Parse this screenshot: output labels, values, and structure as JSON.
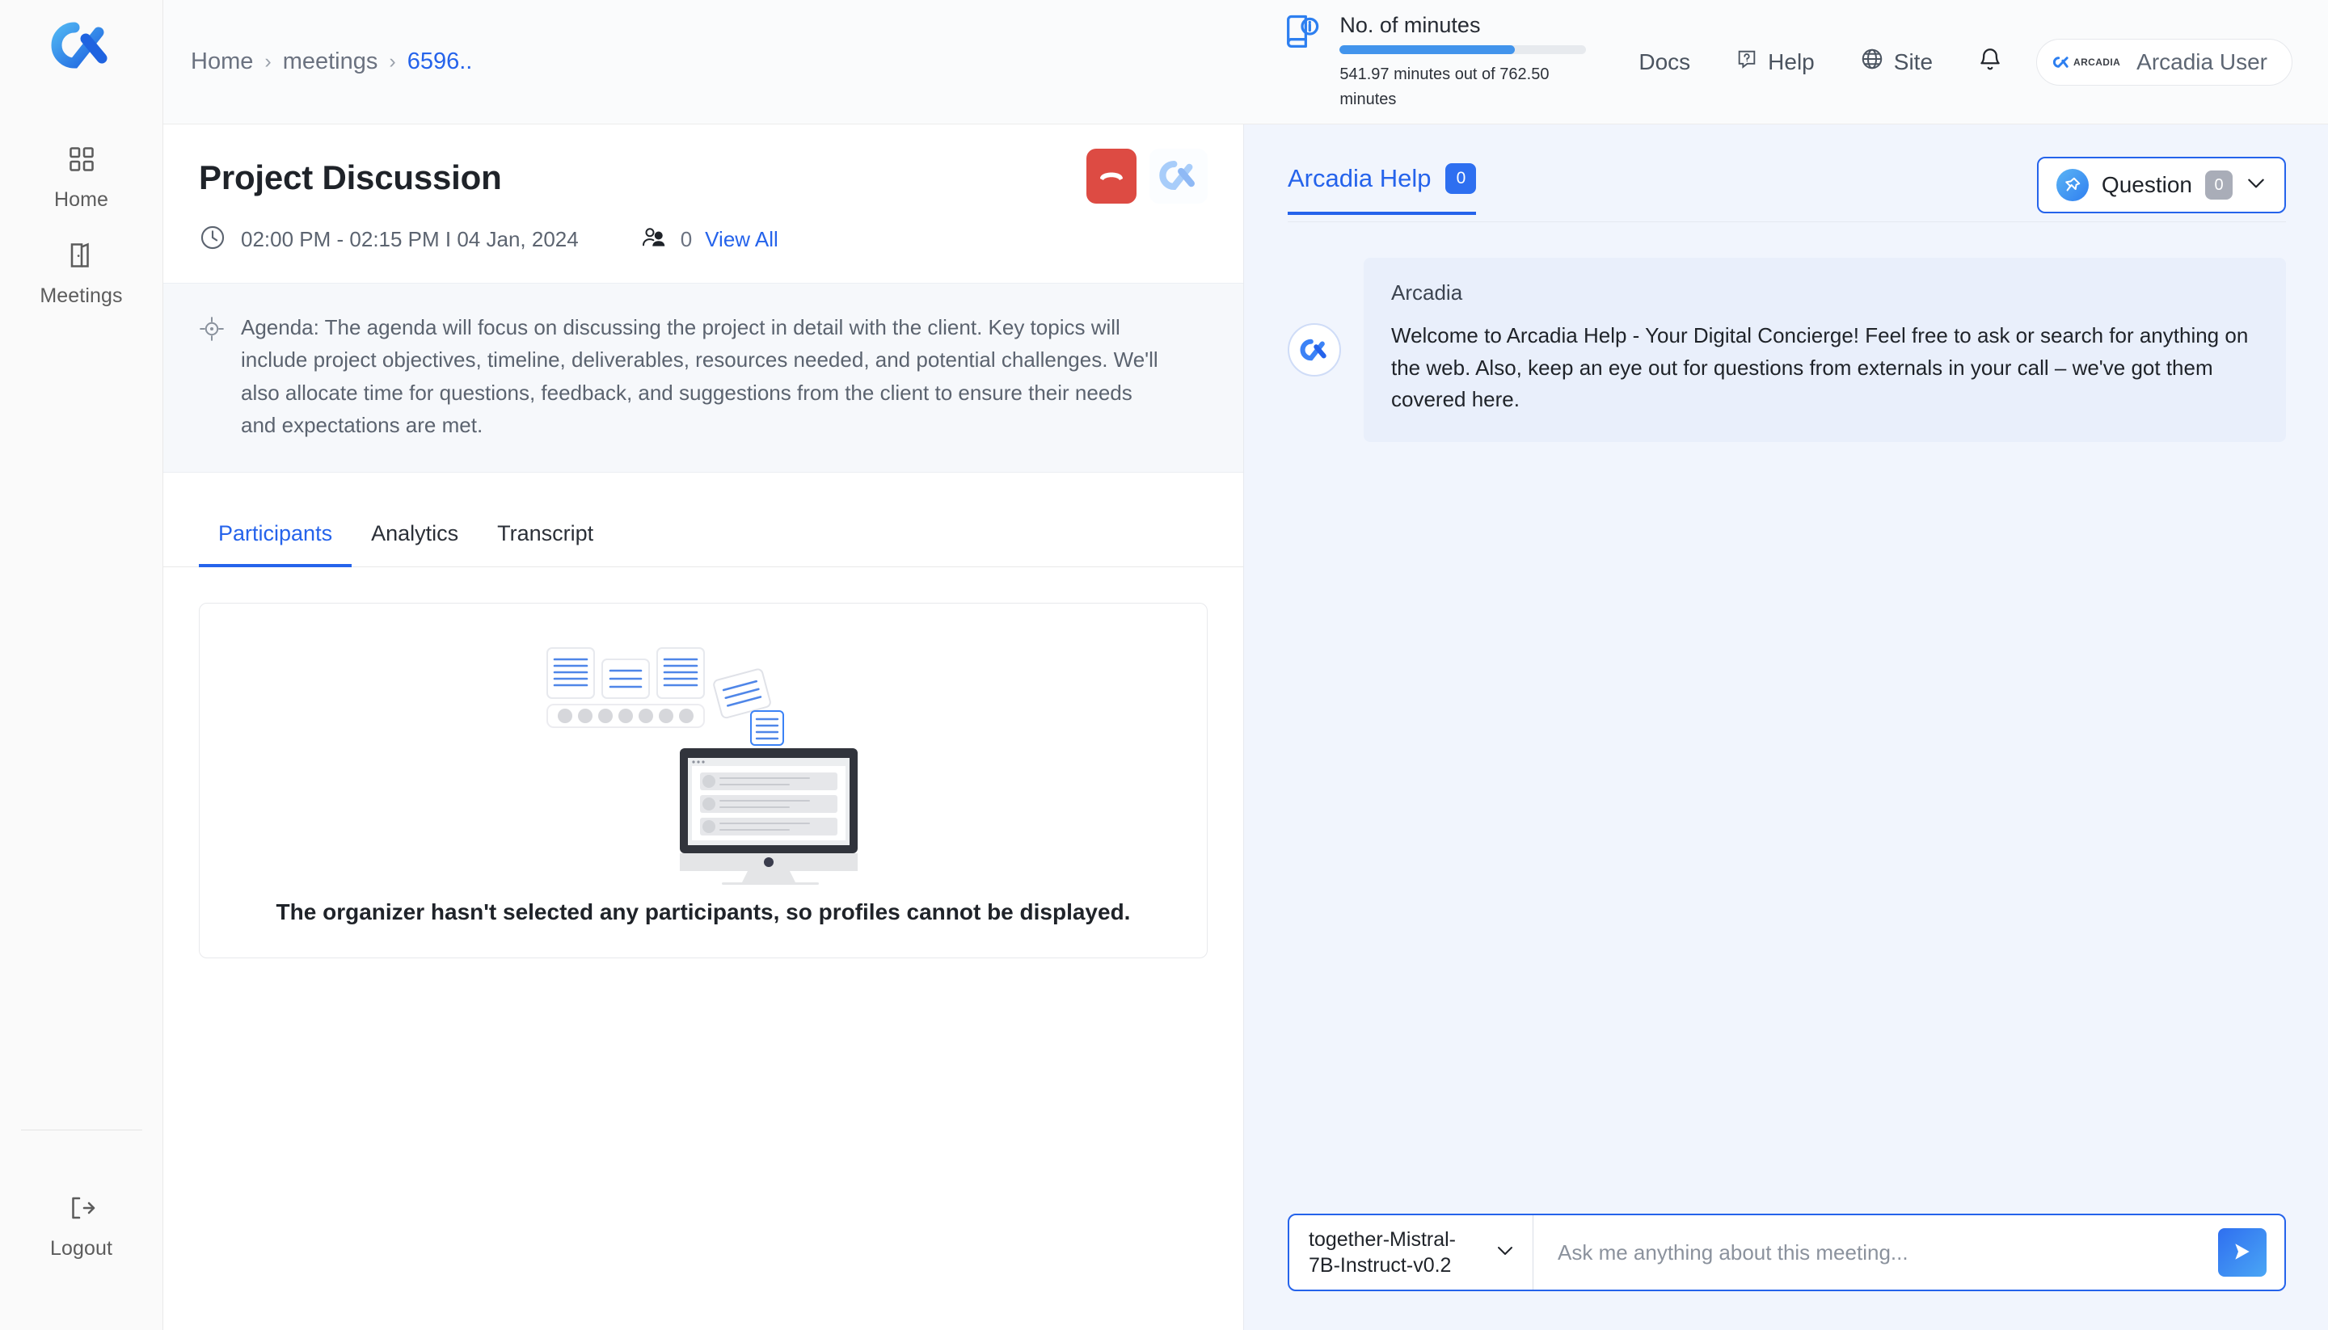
{
  "sidebar": {
    "logo_name": "arcadia-logo",
    "items": [
      {
        "label": "Home",
        "icon": "grid-icon"
      },
      {
        "label": "Meetings",
        "icon": "door-icon"
      }
    ],
    "logout": {
      "label": "Logout",
      "icon": "logout-icon"
    }
  },
  "topbar": {
    "breadcrumb": {
      "home": "Home",
      "section": "meetings",
      "current": "6596..",
      "separator": "›"
    },
    "minutes": {
      "title": "No. of minutes",
      "subtitle": "541.97 minutes out of 762.50 minutes",
      "used": 541.97,
      "total": 762.5,
      "percent": 71,
      "fill_color": "#4294ec",
      "track_color": "#e7eaee"
    },
    "links": [
      {
        "label": "Docs",
        "icon": ""
      },
      {
        "label": "Help",
        "icon": "help-circle-icon"
      },
      {
        "label": "Site",
        "icon": "globe-icon"
      }
    ],
    "notifications_icon": "bell-icon",
    "user": {
      "name": "Arcadia User",
      "badge_text": "ARCADIA"
    }
  },
  "meeting": {
    "title": "Project Discussion",
    "time": "02:00 PM - 02:15 PM I 04 Jan, 2024",
    "participants_count": "0",
    "view_all": "View All",
    "end_call_label": "end-call",
    "agenda": "Agenda: The agenda will focus on discussing the project in detail with the client. Key topics will include project objectives, timeline, deliverables, resources needed, and potential challenges. We'll also allocate time for questions, feedback, and suggestions from the client to ensure their needs and expectations are met.",
    "tabs": [
      {
        "label": "Participants",
        "active": true
      },
      {
        "label": "Analytics",
        "active": false
      },
      {
        "label": "Transcript",
        "active": false
      }
    ],
    "empty_state": "The organizer hasn't selected any participants, so profiles cannot be displayed."
  },
  "right_panel": {
    "tab_label": "Arcadia Help",
    "tab_badge": "0",
    "question_select": {
      "label": "Question",
      "badge": "0"
    },
    "accent_color": "#2563eb",
    "background": "#f1f5fd",
    "messages": [
      {
        "author": "Arcadia",
        "text": "Welcome to Arcadia Help - Your Digital Concierge! Feel free to ask or search for anything on the web. Also, keep an eye out for questions from externals in your call – we've got them covered here."
      }
    ],
    "composer": {
      "model": "together-Mistral-7B-Instruct-v0.2",
      "placeholder": "Ask me anything about this meeting...",
      "input_value": "",
      "send_icon": "send-icon"
    }
  }
}
